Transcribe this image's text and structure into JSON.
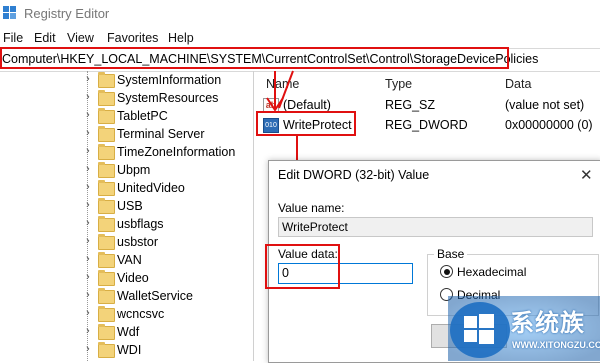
{
  "window": {
    "title": "Registry Editor"
  },
  "menu": [
    "File",
    "Edit",
    "View",
    "Favorites",
    "Help"
  ],
  "address": {
    "path": "Computer\\HKEY_LOCAL_MACHINE\\SYSTEM\\CurrentControlSet\\Control\\StorageDevicePolicies"
  },
  "tree": {
    "items": [
      "SystemInformation",
      "SystemResources",
      "TabletPC",
      "Terminal Server",
      "TimeZoneInformation",
      "Ubpm",
      "UnitedVideo",
      "USB",
      "usbflags",
      "usbstor",
      "VAN",
      "Video",
      "WalletService",
      "wcncsvc",
      "Wdf",
      "WDI"
    ]
  },
  "list": {
    "headers": {
      "name": "Name",
      "type": "Type",
      "data": "Data"
    },
    "rows": [
      {
        "icon": "string-value-icon",
        "icon_text": "ab",
        "name": "(Default)",
        "type": "REG_SZ",
        "data": "(value not set)"
      },
      {
        "icon": "binary-value-icon",
        "icon_text": "010",
        "name": "WriteProtect",
        "type": "REG_DWORD",
        "data": "0x00000000 (0)"
      }
    ]
  },
  "dialog": {
    "title": "Edit DWORD (32-bit) Value",
    "close_glyph": "✕",
    "value_name_label": "Value name:",
    "value_name": "WriteProtect",
    "value_data_label": "Value data:",
    "value_data": "0",
    "base_label": "Base",
    "base_options": [
      "Hexadecimal",
      "Decimal"
    ],
    "base_selected": "Hexadecimal"
  },
  "watermark": {
    "text": "系统族",
    "url": "WWW.XITONGZU.COM"
  },
  "colors": {
    "highlight": "#e01010",
    "accent": "#0078d7"
  }
}
